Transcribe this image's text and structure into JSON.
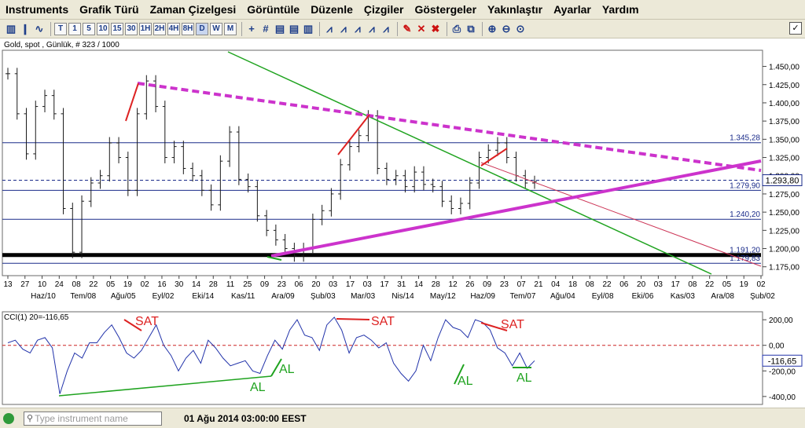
{
  "menubar": {
    "items": [
      "Instruments",
      "Grafik Türü",
      "Zaman Çizelgesi",
      "Görüntüle",
      "Düzenle",
      "Çizgiler",
      "Göstergeler",
      "Yakınlaştır",
      "Ayarlar",
      "Yardım"
    ]
  },
  "toolbar": {
    "periods": [
      "T",
      "1",
      "5",
      "10",
      "15",
      "30",
      "1H",
      "2H",
      "4H",
      "8H",
      "D",
      "W",
      "M"
    ],
    "active_period": "D",
    "icons": [
      "bar-chart-icon",
      "candlestick-icon",
      "line-chart-icon",
      "crosshair-icon",
      "grid-icon",
      "toggle-a-icon",
      "toggle-b-icon",
      "toggle-c-icon",
      "line-tool-1-icon",
      "line-tool-2-icon",
      "line-tool-3-icon",
      "line-tool-4-icon",
      "line-tool-5-icon",
      "pencil-delete-icon",
      "delete-icon",
      "delete-all-icon",
      "print-icon",
      "print-preview-icon",
      "zoom-in-icon",
      "zoom-out-icon",
      "zoom-fit-icon"
    ]
  },
  "chart": {
    "info": "Gold, spot , Günlük, # 323 / 1000",
    "price_badge": "1.293,80",
    "level_labels": [
      "1.345,28",
      "1.279,90",
      "1.240,20",
      "1.191,20",
      "1.179,83"
    ],
    "sat_label": "SAT",
    "al_label": "AL",
    "cci_title": "CCI(1) 20=-116,65",
    "cci_badge": "-116,65",
    "colors": {
      "price": "#1a1a1a",
      "green_line": "#1fa31f",
      "magenta_line": "#cc33cc",
      "red_line": "#dd2222",
      "cci_line": "#2233aa",
      "blue_level": "#1a2b8a",
      "zero_line": "#cc2222"
    }
  },
  "chart_data": [
    {
      "type": "bar",
      "title": "Gold, spot , Günlük",
      "ylim": [
        1165,
        1470
      ],
      "y_tick_labels": [
        "1.450,00",
        "1.425,00",
        "1.400,00",
        "1.375,00",
        "1.350,00",
        "1.325,00",
        "1.300,00",
        "1.275,00",
        "1.250,00",
        "1.225,00",
        "1.200,00",
        "1.175,00"
      ],
      "y_ticks": [
        1450,
        1425,
        1400,
        1375,
        1350,
        1325,
        1300,
        1275,
        1250,
        1225,
        1200,
        1175
      ],
      "x_tick_labels": [
        "13",
        "27",
        "10",
        "24",
        "08",
        "22",
        "05",
        "19",
        "02",
        "16",
        "30",
        "14",
        "28",
        "11",
        "25",
        "09",
        "23",
        "06",
        "20",
        "03",
        "17",
        "03",
        "17",
        "31",
        "14",
        "28",
        "12",
        "26",
        "09",
        "23",
        "07",
        "21",
        "04",
        "18",
        "08",
        "22",
        "06",
        "20",
        "03",
        "17",
        "08",
        "22",
        "05",
        "19",
        "02"
      ],
      "x_month_labels": [
        "Haz/10",
        "Tem/08",
        "Ağu/05",
        "Eyl/02",
        "Eki/14",
        "Kas/11",
        "Ara/09",
        "Şub/03",
        "Mar/03",
        "Nis/14",
        "May/12",
        "Haz/09",
        "Tem/07",
        "Ağu/04",
        "Eyl/08",
        "Eki/06",
        "Kas/03",
        "Ara/08",
        "Şub/02"
      ],
      "close_values": [
        1440,
        1385,
        1330,
        1395,
        1410,
        1385,
        1255,
        1195,
        1265,
        1290,
        1300,
        1345,
        1325,
        1280,
        1385,
        1430,
        1395,
        1325,
        1340,
        1310,
        1300,
        1280,
        1260,
        1320,
        1360,
        1295,
        1285,
        1245,
        1225,
        1212,
        1200,
        1190,
        1200,
        1240,
        1252,
        1275,
        1315,
        1340,
        1355,
        1382,
        1310,
        1295,
        1300,
        1285,
        1305,
        1288,
        1285,
        1265,
        1255,
        1262,
        1290,
        1325,
        1335,
        1345,
        1325,
        1300,
        1290,
        1292
      ],
      "levels": [
        1345.28,
        1279.9,
        1240.2,
        1191.2,
        1179.83
      ],
      "current_price": 1293.8
    },
    {
      "type": "line",
      "title": "CCI(1) 20=-116,65",
      "ylim": [
        -450,
        250
      ],
      "y_tick_labels": [
        "200,00",
        "0,00",
        "-200,00",
        "-400,00"
      ],
      "y_ticks": [
        200,
        0,
        -200,
        -400
      ],
      "values": [
        20,
        40,
        -30,
        -60,
        40,
        60,
        -20,
        -380,
        -200,
        -60,
        -100,
        20,
        20,
        100,
        160,
        60,
        -60,
        -100,
        -40,
        60,
        160,
        0,
        -80,
        -200,
        -100,
        -40,
        -140,
        40,
        -20,
        -100,
        -160,
        -140,
        -120,
        -200,
        -220,
        -80,
        40,
        -30,
        120,
        200,
        80,
        60,
        -40,
        160,
        220,
        120,
        -60,
        60,
        80,
        40,
        -20,
        20,
        -140,
        -220,
        -280,
        -200,
        0,
        -120,
        60,
        200,
        140,
        120,
        60,
        200,
        180,
        120,
        -20,
        -60,
        -160,
        -60,
        -180,
        -120
      ]
    }
  ]
}
